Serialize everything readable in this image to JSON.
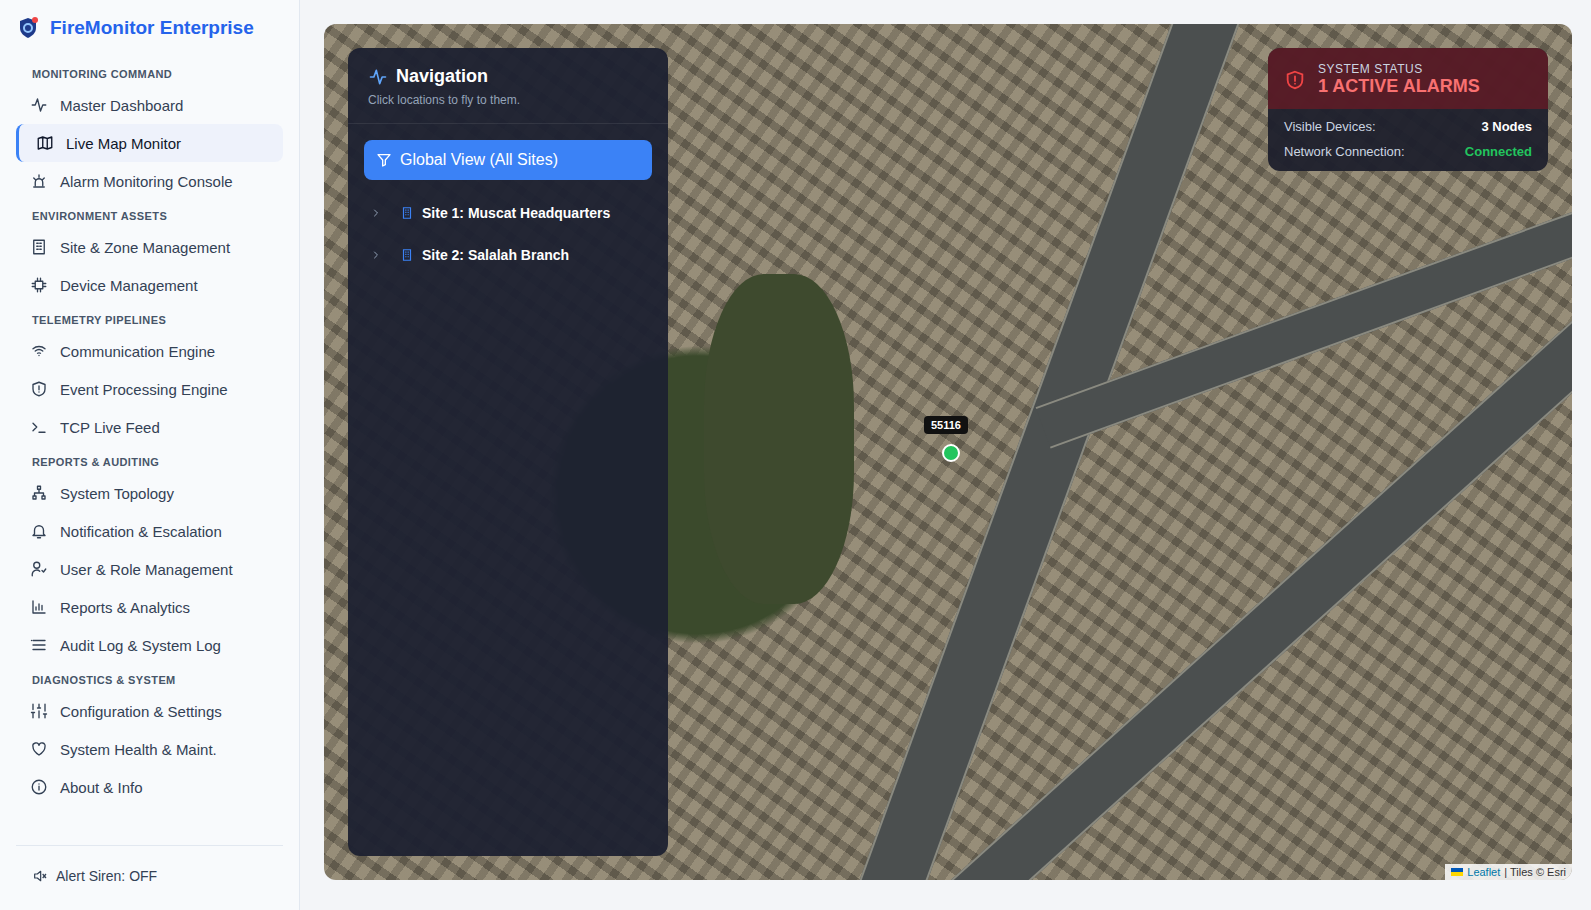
{
  "app": {
    "name": "FireMonitor Enterprise"
  },
  "sidebar": {
    "sections": [
      {
        "title": "MONITORING COMMAND",
        "items": [
          {
            "label": "Master Dashboard",
            "selected": false
          },
          {
            "label": "Live Map Monitor",
            "selected": true
          },
          {
            "label": "Alarm Monitoring Console",
            "selected": false
          }
        ]
      },
      {
        "title": "ENVIRONMENT ASSETS",
        "items": [
          {
            "label": "Site & Zone Management",
            "selected": false
          },
          {
            "label": "Device Management",
            "selected": false
          }
        ]
      },
      {
        "title": "TELEMETRY PIPELINES",
        "items": [
          {
            "label": "Communication Engine",
            "selected": false
          },
          {
            "label": "Event Processing Engine",
            "selected": false
          },
          {
            "label": "TCP Live Feed",
            "selected": false
          }
        ]
      },
      {
        "title": "REPORTS & AUDITING",
        "items": [
          {
            "label": "System Topology",
            "selected": false
          },
          {
            "label": "Notification & Escalation",
            "selected": false
          },
          {
            "label": "User & Role Management",
            "selected": false
          },
          {
            "label": "Reports & Analytics",
            "selected": false
          },
          {
            "label": "Audit Log & System Log",
            "selected": false
          }
        ]
      },
      {
        "title": "DIAGNOSTICS & SYSTEM",
        "items": [
          {
            "label": "Configuration & Settings",
            "selected": false
          },
          {
            "label": "System Health & Maint.",
            "selected": false
          },
          {
            "label": "About & Info",
            "selected": false
          }
        ]
      }
    ],
    "alert_siren": "Alert Siren: OFF"
  },
  "navigation": {
    "title": "Navigation",
    "subtitle": "Click locations to fly to them.",
    "global_button": "Global View (All Sites)",
    "sites": [
      {
        "label": "Site 1: Muscat Headquarters",
        "expanded": false
      },
      {
        "label": "Site 2: Salalah Branch",
        "expanded": false
      }
    ]
  },
  "map": {
    "marker": {
      "label": "55116",
      "color": "#22c55e"
    },
    "attribution": {
      "leaflet": "Leaflet",
      "tiles": "| Tiles © Esri"
    }
  },
  "status": {
    "heading": "SYSTEM STATUS",
    "alarms": "1 ACTIVE ALARMS",
    "rows": [
      {
        "label": "Visible Devices:",
        "value": "3 Nodes",
        "color": "#ffffff"
      },
      {
        "label": "Network Connection:",
        "value": "Connected",
        "color": "#22c55e"
      }
    ]
  }
}
